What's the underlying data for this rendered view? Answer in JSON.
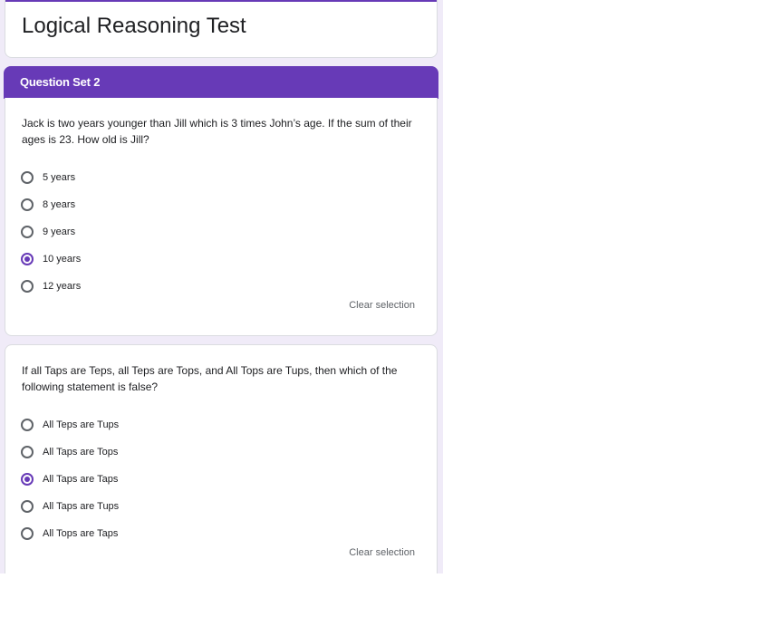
{
  "form": {
    "title": "Logical Reasoning Test",
    "section_label": "Question Set 2"
  },
  "questions": [
    {
      "text": "Jack is two years younger than Jill which is 3 times John’s age. If the sum of their ages is 23. How old is Jill?",
      "options": [
        "5 years",
        "8 years",
        "9 years",
        "10 years",
        "12 years"
      ],
      "selected_index": 3,
      "clear_label": "Clear selection"
    },
    {
      "text": "If all Taps are Teps, all Teps are Tops, and All Tops are Tups, then which of the following statement is false?",
      "options": [
        "All Teps are Tups",
        "All Taps are Tops",
        "All Taps are Taps",
        "All Taps are Tups",
        "All Tops are Taps"
      ],
      "selected_index": 2,
      "clear_label": "Clear selection"
    }
  ],
  "colors": {
    "accent": "#673ab7",
    "page_background": "#f0ebf8",
    "text": "#202124",
    "muted_text": "#5f6368"
  }
}
